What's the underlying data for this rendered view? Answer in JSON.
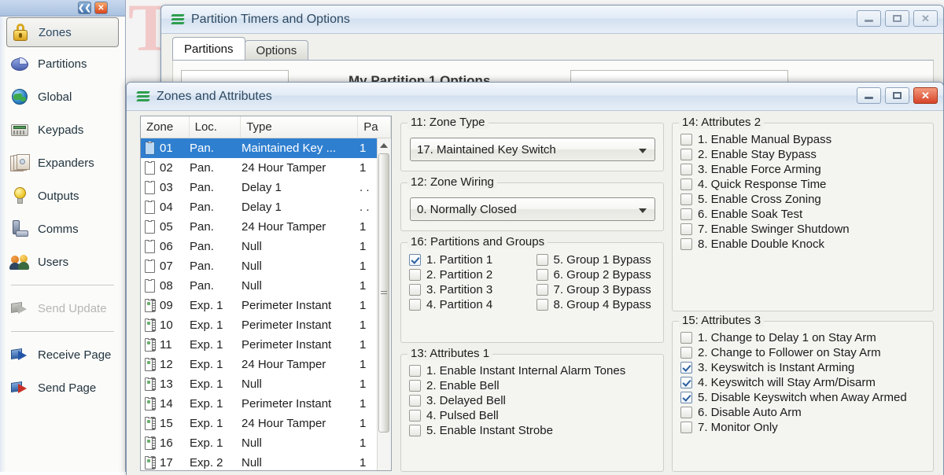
{
  "watermark": "T",
  "sidebar": {
    "window_buttons": [
      {
        "name": "restore",
        "glyph": "❮❮"
      },
      {
        "name": "close",
        "glyph": "✕"
      }
    ],
    "items": [
      {
        "label": "Zones",
        "icon": "lock-icon",
        "selected": true
      },
      {
        "label": "Partitions",
        "icon": "pie-icon",
        "selected": false
      },
      {
        "label": "Global",
        "icon": "globe-icon",
        "selected": false
      },
      {
        "label": "Keypads",
        "icon": "keypad-icon",
        "selected": false
      },
      {
        "label": "Expanders",
        "icon": "expanders-icon",
        "selected": false
      },
      {
        "label": "Outputs",
        "icon": "bulb-icon",
        "selected": false
      },
      {
        "label": "Comms",
        "icon": "phone-icon",
        "selected": false
      },
      {
        "label": "Users",
        "icon": "users-icon",
        "selected": false
      }
    ],
    "actions": [
      {
        "label": "Send Update",
        "icon": "send-update-icon",
        "disabled": true
      },
      {
        "label": "Receive Page",
        "icon": "receive-page-icon",
        "disabled": false
      },
      {
        "label": "Send Page",
        "icon": "send-page-icon",
        "disabled": false
      }
    ]
  },
  "partition_window": {
    "title": "Partition Timers and Options",
    "icon": "app-icon",
    "tabs": [
      {
        "label": "Partitions",
        "active": true
      },
      {
        "label": "Options",
        "active": false
      }
    ],
    "ghost_title": "My Partition 1 Options",
    "buttons": {
      "minimize": "–",
      "maximize": "□",
      "close": "✕"
    }
  },
  "zones_window": {
    "title": "Zones and Attributes",
    "icon": "app-icon",
    "buttons": {
      "minimize": "–",
      "maximize": "□",
      "close": "✕"
    },
    "list": {
      "columns": [
        "Zone",
        "Loc.",
        "Type",
        "Pa"
      ],
      "rows": [
        {
          "icon": "panel-zone-icon",
          "zone": "01",
          "loc": "Pan.",
          "type": "Maintained Key ...",
          "part": "1",
          "selected": true
        },
        {
          "icon": "panel-zone-icon",
          "zone": "02",
          "loc": "Pan.",
          "type": "24 Hour Tamper",
          "part": "1",
          "selected": false
        },
        {
          "icon": "panel-zone-icon",
          "zone": "03",
          "loc": "Pan.",
          "type": "Delay 1",
          "part": ". .",
          "selected": false
        },
        {
          "icon": "panel-zone-icon",
          "zone": "04",
          "loc": "Pan.",
          "type": "Delay 1",
          "part": ". .",
          "selected": false
        },
        {
          "icon": "panel-zone-icon",
          "zone": "05",
          "loc": "Pan.",
          "type": "24 Hour Tamper",
          "part": "1",
          "selected": false
        },
        {
          "icon": "panel-zone-icon",
          "zone": "06",
          "loc": "Pan.",
          "type": "Null",
          "part": "1",
          "selected": false
        },
        {
          "icon": "panel-zone-icon",
          "zone": "07",
          "loc": "Pan.",
          "type": "Null",
          "part": "1",
          "selected": false
        },
        {
          "icon": "panel-zone-icon",
          "zone": "08",
          "loc": "Pan.",
          "type": "Null",
          "part": "1",
          "selected": false
        },
        {
          "icon": "expander-zone-icon",
          "zone": "09",
          "loc": "Exp. 1",
          "type": "Perimeter Instant",
          "part": "1",
          "selected": false
        },
        {
          "icon": "expander-zone-icon",
          "zone": "10",
          "loc": "Exp. 1",
          "type": "Perimeter Instant",
          "part": "1",
          "selected": false
        },
        {
          "icon": "expander-zone-icon",
          "zone": "11",
          "loc": "Exp. 1",
          "type": "Perimeter Instant",
          "part": "1",
          "selected": false
        },
        {
          "icon": "expander-zone-icon",
          "zone": "12",
          "loc": "Exp. 1",
          "type": "24 Hour Tamper",
          "part": "1",
          "selected": false
        },
        {
          "icon": "expander-zone-icon",
          "zone": "13",
          "loc": "Exp. 1",
          "type": "Null",
          "part": "1",
          "selected": false
        },
        {
          "icon": "expander-zone-icon",
          "zone": "14",
          "loc": "Exp. 1",
          "type": "Perimeter Instant",
          "part": "1",
          "selected": false
        },
        {
          "icon": "expander-zone-icon",
          "zone": "15",
          "loc": "Exp. 1",
          "type": "24 Hour Tamper",
          "part": "1",
          "selected": false
        },
        {
          "icon": "expander-zone-icon",
          "zone": "16",
          "loc": "Exp. 1",
          "type": "Null",
          "part": "1",
          "selected": false
        },
        {
          "icon": "expander-zone-icon",
          "zone": "17",
          "loc": "Exp. 2",
          "type": "Null",
          "part": "1",
          "selected": false
        }
      ]
    },
    "zone_type": {
      "legend": "11: Zone Type",
      "value": "17. Maintained Key Switch"
    },
    "zone_wiring": {
      "legend": "12: Zone Wiring",
      "value": "0. Normally Closed"
    },
    "partitions_groups": {
      "legend": "16: Partitions and Groups",
      "left": [
        {
          "label": "1. Partition 1",
          "checked": true
        },
        {
          "label": "2. Partition 2",
          "checked": false
        },
        {
          "label": "3. Partition 3",
          "checked": false
        },
        {
          "label": "4. Partition 4",
          "checked": false
        }
      ],
      "right": [
        {
          "label": "5. Group 1 Bypass",
          "checked": false
        },
        {
          "label": "6. Group 2 Bypass",
          "checked": false
        },
        {
          "label": "7. Group 3 Bypass",
          "checked": false
        },
        {
          "label": "8. Group 4 Bypass",
          "checked": false
        }
      ]
    },
    "attributes_1": {
      "legend": "13: Attributes 1",
      "items": [
        {
          "label": "1. Enable Instant Internal Alarm Tones",
          "checked": false
        },
        {
          "label": "2. Enable Bell",
          "checked": false
        },
        {
          "label": "3. Delayed Bell",
          "checked": false
        },
        {
          "label": "4. Pulsed Bell",
          "checked": false
        },
        {
          "label": "5. Enable Instant Strobe",
          "checked": false
        }
      ]
    },
    "attributes_2": {
      "legend": "14: Attributes 2",
      "items": [
        {
          "label": "1. Enable Manual Bypass",
          "checked": false
        },
        {
          "label": "2. Enable Stay Bypass",
          "checked": false
        },
        {
          "label": "3. Enable Force Arming",
          "checked": false
        },
        {
          "label": "4. Quick Response Time",
          "checked": false
        },
        {
          "label": "5. Enable Cross Zoning",
          "checked": false
        },
        {
          "label": "6. Enable Soak Test",
          "checked": false
        },
        {
          "label": "7. Enable Swinger Shutdown",
          "checked": false
        },
        {
          "label": "8. Enable Double Knock",
          "checked": false
        }
      ]
    },
    "attributes_3": {
      "legend": "15: Attributes 3",
      "items": [
        {
          "label": "1. Change to Delay 1 on Stay Arm",
          "checked": false
        },
        {
          "label": "2. Change to Follower on Stay Arm",
          "checked": false
        },
        {
          "label": "3. Keyswitch is Instant Arming",
          "checked": true
        },
        {
          "label": "4. Keyswitch will Stay Arm/Disarm",
          "checked": true
        },
        {
          "label": "5. Disable Keyswitch when Away Armed",
          "checked": true
        },
        {
          "label": "6. Disable Auto Arm",
          "checked": false
        },
        {
          "label": "7. Monitor Only",
          "checked": false
        }
      ]
    }
  },
  "colors": {
    "selection_blue": "#2f7fd0",
    "title_text": "#2d4a63",
    "close_red": "#d6442a",
    "watermark_red": "#f2c9c9"
  }
}
